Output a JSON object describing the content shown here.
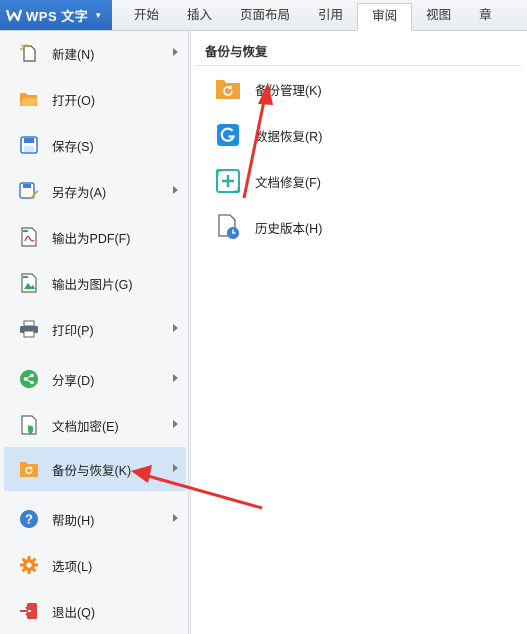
{
  "app": {
    "title": "WPS 文字"
  },
  "tabs": [
    {
      "label": "开始",
      "active": false
    },
    {
      "label": "插入",
      "active": false
    },
    {
      "label": "页面布局",
      "active": false
    },
    {
      "label": "引用",
      "active": false
    },
    {
      "label": "审阅",
      "active": true
    },
    {
      "label": "视图",
      "active": false
    },
    {
      "label": "章",
      "active": false
    }
  ],
  "menu": {
    "items": [
      {
        "label": "新建(N)",
        "icon": "new-doc-icon",
        "submenu": true
      },
      {
        "label": "打开(O)",
        "icon": "open-folder-icon",
        "submenu": false
      },
      {
        "label": "保存(S)",
        "icon": "save-icon",
        "submenu": false
      },
      {
        "label": "另存为(A)",
        "icon": "save-as-icon",
        "submenu": true
      },
      {
        "label": "输出为PDF(F)",
        "icon": "export-pdf-icon",
        "submenu": false
      },
      {
        "label": "输出为图片(G)",
        "icon": "export-image-icon",
        "submenu": false
      },
      {
        "label": "打印(P)",
        "icon": "print-icon",
        "submenu": true
      },
      {
        "label": "分享(D)",
        "icon": "share-icon",
        "submenu": true
      },
      {
        "label": "文档加密(E)",
        "icon": "encrypt-icon",
        "submenu": true
      },
      {
        "label": "备份与恢复(K)",
        "icon": "backup-icon",
        "submenu": true,
        "selected": true
      },
      {
        "label": "帮助(H)",
        "icon": "help-icon",
        "submenu": true
      },
      {
        "label": "选项(L)",
        "icon": "gear-icon",
        "submenu": false
      },
      {
        "label": "退出(Q)",
        "icon": "exit-icon",
        "submenu": false
      }
    ]
  },
  "submenu": {
    "title": "备份与恢复",
    "items": [
      {
        "label": "备份管理(K)",
        "icon": "backup-manage-icon"
      },
      {
        "label": "数据恢复(R)",
        "icon": "data-recovery-icon"
      },
      {
        "label": "文档修复(F)",
        "icon": "doc-repair-icon"
      },
      {
        "label": "历史版本(H)",
        "icon": "history-icon"
      }
    ]
  },
  "colors": {
    "accent": "#2a6bc2",
    "selected_bg": "#d3e4f7",
    "annotation_arrow": "#e8322e"
  }
}
